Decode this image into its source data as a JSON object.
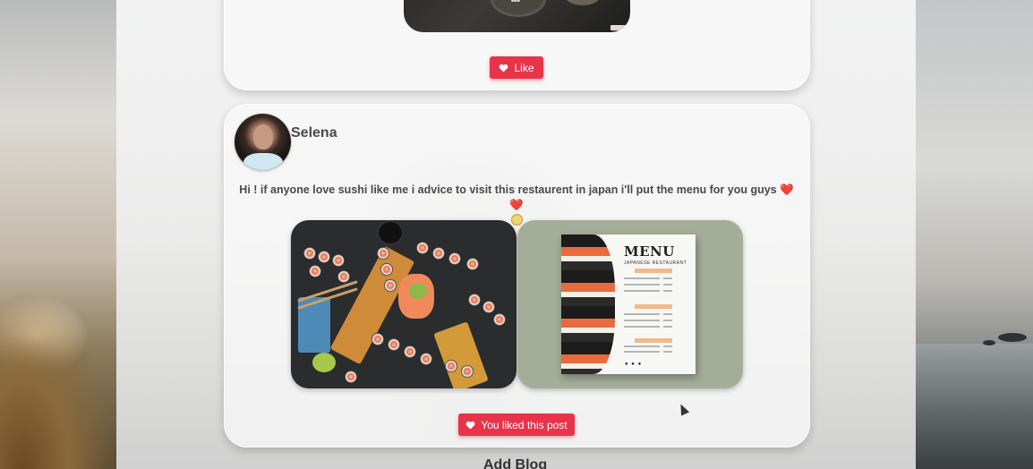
{
  "previous_post": {
    "like_label": "Like"
  },
  "post": {
    "username": "Selena",
    "text": "Hi ! if anyone love sushi like me i advice to visit this restaurent in japan i'll put the menu for you guys",
    "text_hearts": "❤️❤️",
    "liked_label": "You liked this post",
    "images": [
      {
        "subject": "sushi platter"
      },
      {
        "subject": "japanese restaurant menu"
      }
    ],
    "menu_image_text": {
      "title": "MENU",
      "subtitle": "JAPANESE RESTAURANT"
    }
  },
  "footer": {
    "add_blog_label": "Add Blog"
  },
  "colors": {
    "accent": "#e8344a",
    "username": "#4a4a4a"
  },
  "icons": [
    "heart-icon",
    "avatar",
    "copy-icon"
  ]
}
